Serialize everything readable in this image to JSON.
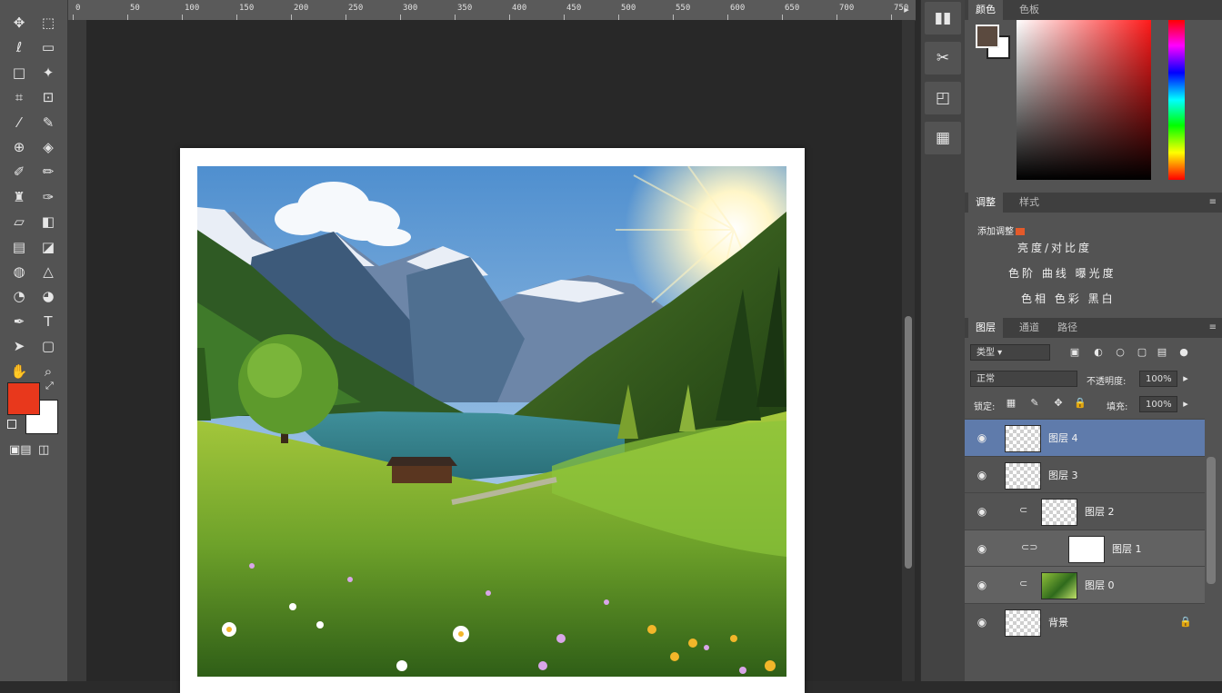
{
  "ruler": {
    "labels": [
      "0",
      "50",
      "100",
      "150",
      "200",
      "250",
      "300",
      "350",
      "400",
      "450",
      "500",
      "550",
      "600",
      "650",
      "700",
      "750"
    ]
  },
  "toolbar": {
    "tools": [
      {
        "name": "move-tool-icon",
        "glyph": "✥"
      },
      {
        "name": "artboard-tool-icon",
        "glyph": "⬚"
      },
      {
        "name": "lasso-tool-icon",
        "glyph": "ℓ"
      },
      {
        "name": "marquee-tool-icon",
        "glyph": "▭"
      },
      {
        "name": "rect-select-icon",
        "glyph": "□"
      },
      {
        "name": "magic-wand-icon",
        "glyph": "✦"
      },
      {
        "name": "crop-tool-icon",
        "glyph": "⌗"
      },
      {
        "name": "frame-tool-icon",
        "glyph": "⊡"
      },
      {
        "name": "eyedropper-icon",
        "glyph": "⁄"
      },
      {
        "name": "slice-tool-icon",
        "glyph": "✎"
      },
      {
        "name": "healing-brush-icon",
        "glyph": "⊕"
      },
      {
        "name": "patch-tool-icon",
        "glyph": "◈"
      },
      {
        "name": "brush-tool-icon",
        "glyph": "✐"
      },
      {
        "name": "pencil-tool-icon",
        "glyph": "✏"
      },
      {
        "name": "clone-stamp-icon",
        "glyph": "♜"
      },
      {
        "name": "history-brush-icon",
        "glyph": "✑"
      },
      {
        "name": "eraser-icon",
        "glyph": "▱"
      },
      {
        "name": "bg-eraser-icon",
        "glyph": "◧"
      },
      {
        "name": "gradient-tool-icon",
        "glyph": "▤"
      },
      {
        "name": "paint-bucket-icon",
        "glyph": "◪"
      },
      {
        "name": "blur-tool-icon",
        "glyph": "◍"
      },
      {
        "name": "sharpen-tool-icon",
        "glyph": "△"
      },
      {
        "name": "dodge-tool-icon",
        "glyph": "◔"
      },
      {
        "name": "burn-tool-icon",
        "glyph": "◕"
      },
      {
        "name": "pen-tool-icon",
        "glyph": "✒"
      },
      {
        "name": "type-tool-icon",
        "glyph": "T"
      },
      {
        "name": "path-select-icon",
        "glyph": "➤"
      },
      {
        "name": "rectangle-tool-icon",
        "glyph": "▢"
      },
      {
        "name": "hand-tool-icon",
        "glyph": "✋"
      },
      {
        "name": "zoom-tool-icon",
        "glyph": "⌕"
      }
    ]
  },
  "strip": {
    "buttons": [
      {
        "name": "history-panel-icon",
        "glyph": "▮▮"
      },
      {
        "name": "brush-settings-icon",
        "glyph": "✂"
      },
      {
        "name": "navigator-panel-icon",
        "glyph": "◰"
      },
      {
        "name": "libraries-panel-icon",
        "glyph": "▦"
      }
    ]
  },
  "panels": {
    "color": {
      "tab_active": "颜色",
      "tab_other": "色板",
      "menu": "≡"
    },
    "adjustments": {
      "tab_active": "调整",
      "tab_other": "样式",
      "menu": "≡",
      "selected_label": "添加调整",
      "row1": "亮度/对比度",
      "row2": "色阶 曲线 曝光度",
      "row3": "色相 色彩 黑白"
    },
    "layers": {
      "tab_active": "图层",
      "tab_2": "通道",
      "tab_3": "路径",
      "menu": "≡",
      "filter_label": "类型",
      "mode_label": "正常",
      "opacity_label": "不透明度:",
      "opacity_value": "100%",
      "lock_label": "锁定:",
      "fill_label": "填充:",
      "fill_value": "100%",
      "rows": [
        {
          "name": "图层 4",
          "thumb": "transparent",
          "indent": false,
          "selected": true,
          "shaded": false,
          "chain": ""
        },
        {
          "name": "图层 3",
          "thumb": "transparent",
          "indent": false,
          "selected": false,
          "shaded": false,
          "chain": ""
        },
        {
          "name": "图层 2",
          "thumb": "transparent",
          "indent": true,
          "selected": false,
          "shaded": false,
          "chain": "⊂"
        },
        {
          "name": "图层 1",
          "thumb": "white",
          "indent": true,
          "selected": false,
          "shaded": true,
          "chain": "⊂⊃"
        },
        {
          "name": "图层 0",
          "thumb": "grass",
          "indent": true,
          "selected": false,
          "shaded": true,
          "chain": "⊂"
        },
        {
          "name": "背景",
          "thumb": "transparent",
          "indent": false,
          "selected": false,
          "shaded": false,
          "chain": "",
          "lock": "🔒"
        }
      ]
    }
  },
  "colors": {
    "foreground": "#e8381c",
    "background": "#ffffff",
    "selected_layer": "#5f7bab"
  }
}
